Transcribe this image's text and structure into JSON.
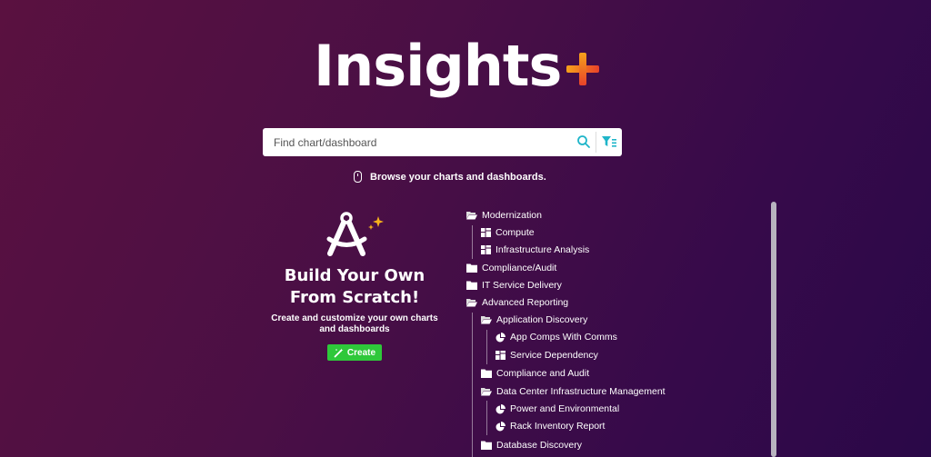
{
  "logo": {
    "text": "Insights"
  },
  "search": {
    "placeholder": "Find chart/dashboard",
    "value": ""
  },
  "browse": {
    "text": "Browse your charts and dashboards."
  },
  "build": {
    "title_line1": "Build Your Own",
    "title_line2": "From Scratch!",
    "description": "Create and customize your own charts and dashboards",
    "create_label": "Create"
  },
  "colors": {
    "accent_orange": "#f7a21b",
    "plus_red": "#e8422a",
    "create_green": "#2ec83a",
    "search_icon": "#1fb5c9"
  },
  "tree": [
    {
      "label": "Modernization",
      "icon": "folder-open-icon",
      "level": 0
    },
    {
      "label": "Compute",
      "icon": "dashboard-icon",
      "level": 1
    },
    {
      "label": "Infrastructure Analysis",
      "icon": "dashboard-icon",
      "level": 1
    },
    {
      "label": "Compliance/Audit",
      "icon": "folder-icon",
      "level": 0
    },
    {
      "label": "IT Service Delivery",
      "icon": "folder-icon",
      "level": 0
    },
    {
      "label": "Advanced Reporting",
      "icon": "folder-open-icon",
      "level": 0
    },
    {
      "label": "Application Discovery",
      "icon": "folder-open-icon",
      "level": 1
    },
    {
      "label": "App Comps With Comms",
      "icon": "pie-chart-icon",
      "level": 2
    },
    {
      "label": "Service Dependency",
      "icon": "dashboard-icon",
      "level": 2
    },
    {
      "label": "Compliance and Audit",
      "icon": "folder-icon",
      "level": 1
    },
    {
      "label": "Data Center Infrastructure Management",
      "icon": "folder-open-icon",
      "level": 1
    },
    {
      "label": "Power and Environmental",
      "icon": "pie-chart-icon",
      "level": 2
    },
    {
      "label": "Rack Inventory Report",
      "icon": "pie-chart-icon",
      "level": 2
    },
    {
      "label": "Database Discovery",
      "icon": "folder-icon",
      "level": 1
    }
  ]
}
